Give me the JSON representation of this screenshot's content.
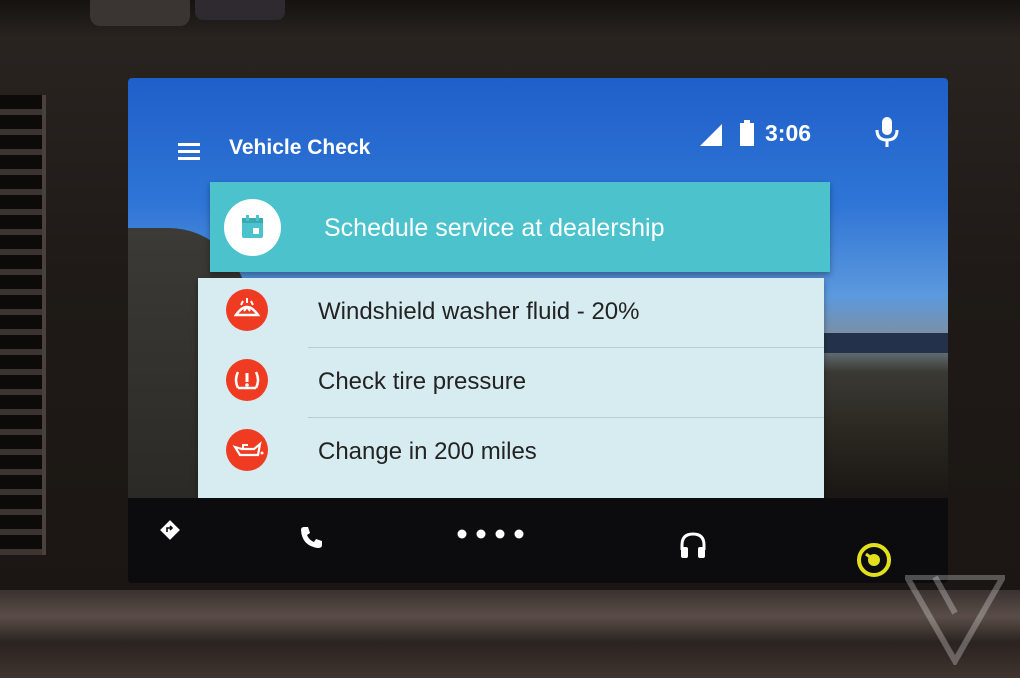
{
  "header": {
    "title": "Vehicle Check",
    "clock": "3:06"
  },
  "primary_action": {
    "label": "Schedule service at dealership",
    "icon": "calendar-icon"
  },
  "items": [
    {
      "label": "Windshield washer fluid - 20%",
      "icon": "windshield-washer-icon"
    },
    {
      "label": "Check tire pressure",
      "icon": "tire-pressure-warning-icon"
    },
    {
      "label": "Change in 200 miles",
      "icon": "oil-can-icon"
    }
  ],
  "navbar": {
    "items": [
      "navigation-icon",
      "phone-icon",
      "overview-dots-icon",
      "headphones-icon",
      "home-icon"
    ]
  },
  "colors": {
    "accent": "#4cc3cc",
    "warning": "#ee3b21",
    "card_background": "#d6ecf0",
    "home_icon": "#e2df1f"
  }
}
